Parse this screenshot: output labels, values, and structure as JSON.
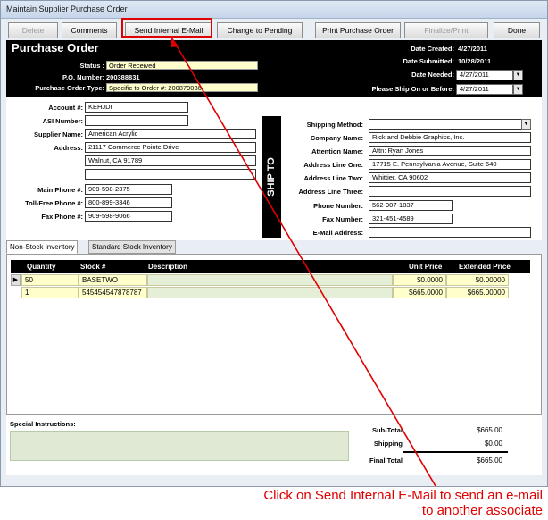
{
  "window": {
    "title": "Maintain Supplier Purchase Order"
  },
  "toolbar": {
    "delete": "Delete",
    "comments": "Comments",
    "send_email": "Send Internal E-Mail",
    "change_pending": "Change to Pending",
    "print_po": "Print Purchase Order",
    "finalize": "Finalize/Print",
    "done": "Done"
  },
  "header": {
    "title": "Purchase Order",
    "status_label": "Status :",
    "status_value": "Order Received",
    "po_label": "P.O. Number:",
    "po_value": "200388831",
    "type_label": "Purchase Order Type:",
    "type_value": "Specific to Order #: 200879036",
    "date_created_label": "Date Created:",
    "date_created_value": "4/27/2011",
    "date_submitted_label": "Date Submitted:",
    "date_submitted_value": "10/28/2011",
    "date_needed_label": "Date Needed:",
    "date_needed_value": "4/27/2011",
    "ship_before_label": "Please Ship On or Before:",
    "ship_before_value": "4/27/2011"
  },
  "supplier": {
    "account_label": "Account #:",
    "account_value": "KEHJDI",
    "asi_label": "ASI Number:",
    "asi_value": "",
    "name_label": "Supplier Name:",
    "name_value": "American Acrylic",
    "address_label": "Address:",
    "address1": "21117 Commerce Pointe Drive",
    "address2": "Walnut, CA 91789",
    "address3": "",
    "main_phone_label": "Main Phone #:",
    "main_phone_value": "909-598-2375",
    "tollfree_label": "Toll-Free Phone #:",
    "tollfree_value": "800-899-3346",
    "fax_label": "Fax Phone #:",
    "fax_value": "909-598-9066"
  },
  "ship_to": {
    "band_label": "SHIP TO",
    "method_label": "Shipping Method:",
    "method_value": "",
    "company_label": "Company Name:",
    "company_value": "Rick and Debbie Graphics, Inc.",
    "attention_label": "Attention Name:",
    "attention_value": "Attn: Ryan Jones",
    "line1_label": "Address Line One:",
    "line1_value": "17715 E. Pennsylvania Avenue, Suite 640",
    "line2_label": "Address Line Two:",
    "line2_value": "Whittier, CA  90602",
    "line3_label": "Address Line Three:",
    "line3_value": "",
    "phone_label": "Phone Number:",
    "phone_value": "562-907-1837",
    "fax_label": "Fax Number:",
    "fax_value": "321-451-4589",
    "email_label": "E-Mail Address:",
    "email_value": ""
  },
  "tabs": {
    "nonstock": "Non-Stock Inventory",
    "standard": "Standard Stock Inventory"
  },
  "grid": {
    "columns": {
      "quantity": "Quantity",
      "stock": "Stock #",
      "description": "Description",
      "unit_price": "Unit Price",
      "extended": "Extended Price"
    },
    "rows": [
      {
        "quantity": "50",
        "stock": "BASETWO",
        "description": "",
        "unit_price": "$0.0000",
        "extended": "$0.00000"
      },
      {
        "quantity": "1",
        "stock": "545454547878787",
        "description": "",
        "unit_price": "$665.0000",
        "extended": "$665.00000"
      }
    ]
  },
  "footer": {
    "special_label": "Special Instructions:",
    "subtotal_label": "Sub-Total",
    "subtotal_value": "$665.00",
    "shipping_label": "Shipping",
    "shipping_value": "$0.00",
    "final_label": "Final Total",
    "final_value": "$665.00"
  },
  "annotation": {
    "text": "Click on Send Internal E-Mail to send an e-mail to another associate",
    "color": "#e00000"
  }
}
